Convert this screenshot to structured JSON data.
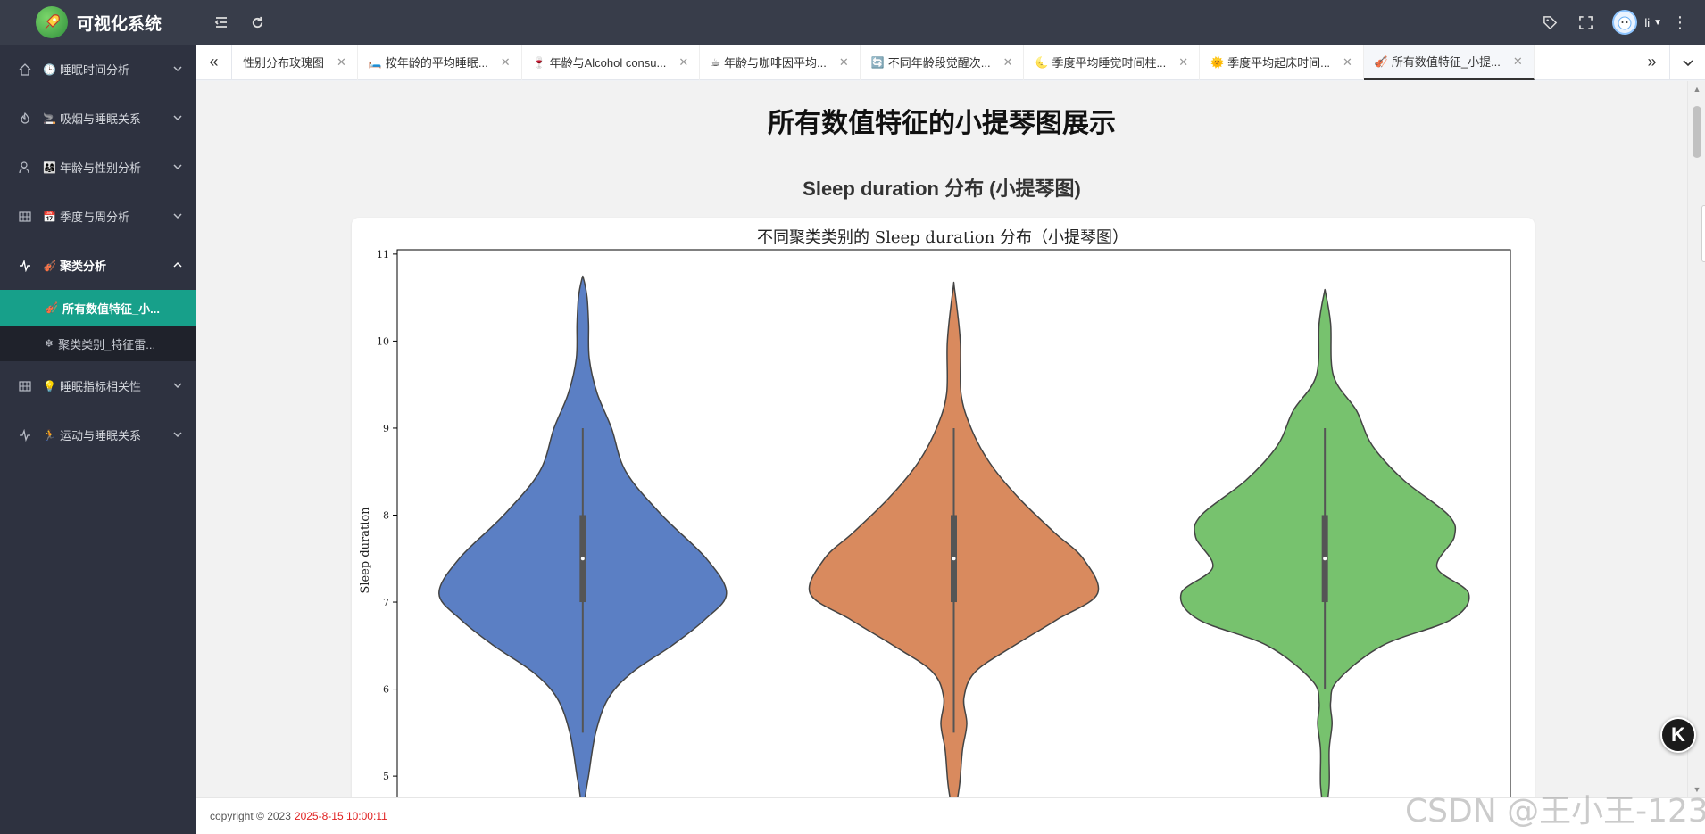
{
  "app": {
    "title": "可视化系统"
  },
  "header": {
    "user_name": "li",
    "icons": [
      "menu-fold-icon",
      "refresh-icon",
      "tag-icon",
      "fullscreen-icon",
      "more-vertical-icon"
    ]
  },
  "sidebar": {
    "items": [
      {
        "emoji": "🕒",
        "label": "睡眠时间分析",
        "icon": "home-icon",
        "expanded": false
      },
      {
        "emoji": "🚬",
        "label": "吸烟与睡眠关系",
        "icon": "fire-icon",
        "expanded": false
      },
      {
        "emoji": "👨‍👩‍👧",
        "label": "年龄与性别分析",
        "icon": "user-icon",
        "expanded": false
      },
      {
        "emoji": "📅",
        "label": "季度与周分析",
        "icon": "grid-icon",
        "expanded": false
      },
      {
        "emoji": "🎻",
        "label": "聚类分析",
        "icon": "pulse-icon",
        "expanded": true,
        "children": [
          {
            "emoji": "🎻",
            "label": "所有数值特征_小...",
            "active": true
          },
          {
            "emoji": "❄",
            "label": "聚类类别_特征雷...",
            "active": false
          }
        ]
      },
      {
        "emoji": "💡",
        "label": "睡眠指标相关性",
        "icon": "grid-icon",
        "expanded": false
      },
      {
        "emoji": "🏃",
        "label": "运动与睡眠关系",
        "icon": "pulse-icon",
        "expanded": false
      }
    ]
  },
  "tabs": [
    {
      "emoji": "",
      "label": "性别分布玫瑰图",
      "active": false
    },
    {
      "emoji": "🛏️",
      "label": "按年龄的平均睡眠...",
      "active": false
    },
    {
      "emoji": "🍷",
      "label": "年龄与Alcohol consu...",
      "active": false
    },
    {
      "emoji": "☕",
      "label": "年龄与咖啡因平均...",
      "active": false
    },
    {
      "emoji": "🔄",
      "label": "不同年龄段觉醒次...",
      "active": false
    },
    {
      "emoji": "🌜",
      "label": "季度平均睡觉时间柱...",
      "active": false
    },
    {
      "emoji": "🌞",
      "label": "季度平均起床时间...",
      "active": false
    },
    {
      "emoji": "🎻",
      "label": "所有数值特征_小提...",
      "active": true
    }
  ],
  "main": {
    "page_title": "所有数值特征的小提琴图展示",
    "section_title": "Sleep duration 分布 (小提琴图)"
  },
  "chart_data": {
    "type": "violin",
    "title": "不同聚类类别的 Sleep duration 分布（小提琴图）",
    "ylabel": "Sleep duration",
    "xlabel": "",
    "ylim": [
      4.55,
      11.05
    ],
    "yticks": [
      5,
      6,
      7,
      8,
      9,
      10,
      11
    ],
    "grid": false,
    "series": [
      {
        "color": "#5b7fc4",
        "min": 5.5,
        "q1": 7.0,
        "median": 7.5,
        "q3": 8.0,
        "max": 9.0,
        "density": [
          [
            4.55,
            0.005
          ],
          [
            4.8,
            0.02
          ],
          [
            5.0,
            0.04
          ],
          [
            5.5,
            0.09
          ],
          [
            5.9,
            0.18
          ],
          [
            6.2,
            0.35
          ],
          [
            6.5,
            0.62
          ],
          [
            6.8,
            0.85
          ],
          [
            7.1,
            1.0
          ],
          [
            7.5,
            0.86
          ],
          [
            8.0,
            0.55
          ],
          [
            8.5,
            0.3
          ],
          [
            9.0,
            0.2
          ],
          [
            9.4,
            0.1
          ],
          [
            9.8,
            0.045
          ],
          [
            10.2,
            0.04
          ],
          [
            10.5,
            0.03
          ],
          [
            10.72,
            0.005
          ]
        ]
      },
      {
        "color": "#d98a5e",
        "min": 5.5,
        "q1": 7.0,
        "median": 7.5,
        "q3": 8.0,
        "max": 9.0,
        "density": [
          [
            4.55,
            0.005
          ],
          [
            4.9,
            0.04
          ],
          [
            5.3,
            0.06
          ],
          [
            5.6,
            0.09
          ],
          [
            5.9,
            0.07
          ],
          [
            6.2,
            0.15
          ],
          [
            6.5,
            0.42
          ],
          [
            6.8,
            0.72
          ],
          [
            7.1,
            1.0
          ],
          [
            7.5,
            0.9
          ],
          [
            7.8,
            0.7
          ],
          [
            8.2,
            0.45
          ],
          [
            8.6,
            0.25
          ],
          [
            9.0,
            0.12
          ],
          [
            9.4,
            0.05
          ],
          [
            10.0,
            0.045
          ],
          [
            10.6,
            0.005
          ]
        ]
      },
      {
        "color": "#77c26e",
        "min": 6.0,
        "q1": 7.0,
        "median": 7.5,
        "q3": 8.0,
        "max": 9.0,
        "density": [
          [
            4.55,
            0.005
          ],
          [
            4.9,
            0.03
          ],
          [
            5.3,
            0.03
          ],
          [
            5.6,
            0.05
          ],
          [
            5.85,
            0.04
          ],
          [
            6.1,
            0.09
          ],
          [
            6.5,
            0.4
          ],
          [
            6.8,
            0.88
          ],
          [
            7.1,
            1.0
          ],
          [
            7.4,
            0.78
          ],
          [
            7.75,
            0.9
          ],
          [
            8.0,
            0.86
          ],
          [
            8.4,
            0.55
          ],
          [
            8.8,
            0.33
          ],
          [
            9.2,
            0.22
          ],
          [
            9.6,
            0.06
          ],
          [
            10.2,
            0.04
          ],
          [
            10.55,
            0.005
          ]
        ]
      }
    ]
  },
  "footer": {
    "copyright": "copyright © 2023",
    "timestamp": "2025-8-15 10:00:11"
  },
  "watermark": "CSDN @王小王-123",
  "floating_button": {
    "label": "K"
  }
}
